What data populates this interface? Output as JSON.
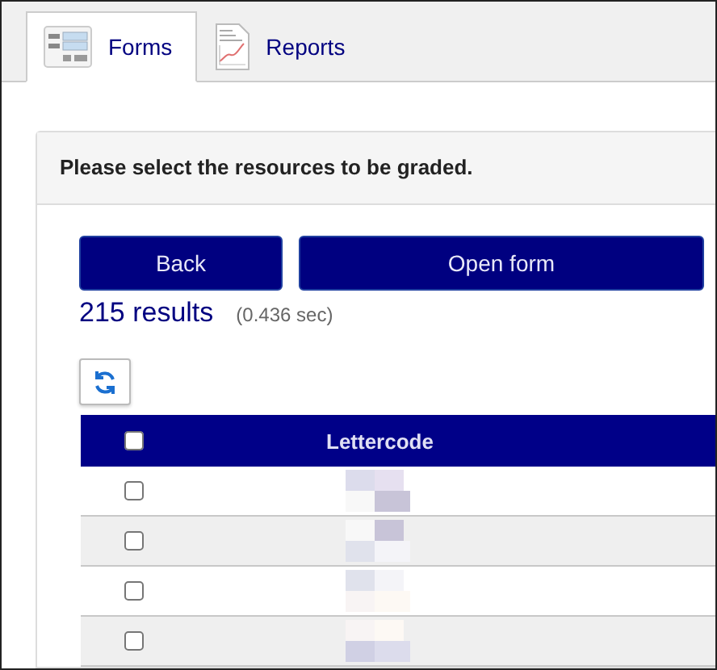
{
  "tabs": [
    {
      "label": "Forms",
      "kind": "form",
      "selected": true
    },
    {
      "label": "Reports",
      "kind": "report",
      "selected": false
    }
  ],
  "panel": {
    "heading": "Please select the resources to be graded.",
    "buttons": [
      "Back",
      "Open form"
    ],
    "result_count": "215 results",
    "result_time": "(0.436 sec)",
    "table": {
      "select_all_checked": false,
      "columns": [
        "Lettercode"
      ],
      "rows": [
        {
          "checked": false
        },
        {
          "checked": false
        },
        {
          "checked": false
        },
        {
          "checked": false
        }
      ]
    }
  }
}
